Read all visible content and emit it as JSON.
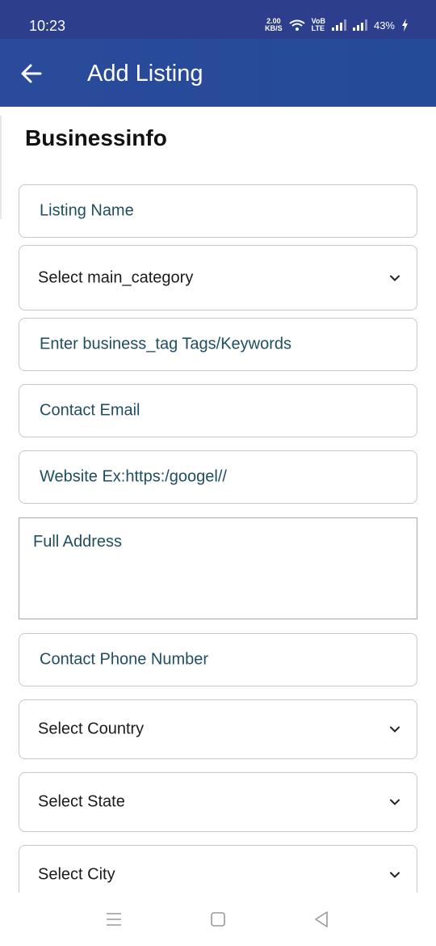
{
  "status_bar": {
    "time": "10:23",
    "net_speed_value": "2.00",
    "net_speed_unit": "KB/S",
    "volte_top": "VoB",
    "volte_bottom": "LTE",
    "battery": "43%"
  },
  "app_bar": {
    "title": "Add Listing",
    "back_icon": "arrow-left-icon"
  },
  "section": {
    "title": "Businessinfo"
  },
  "form": {
    "listing_name_placeholder": "Listing Name",
    "main_category_value": "Select  main_category",
    "tags_placeholder": "Enter business_tag Tags/Keywords",
    "email_placeholder": "Contact Email",
    "website_placeholder": "Website Ex:https:/googel//",
    "address_placeholder": "Full Address",
    "phone_placeholder": "Contact Phone Number",
    "country_value": "Select Country",
    "state_value": "Select State",
    "city_value": "Select City"
  },
  "nav": {
    "menu_icon": "recent-apps-icon",
    "home_icon": "home-icon",
    "back_icon": "nav-back-icon"
  },
  "colors": {
    "status_bar": "#2d3e8d",
    "app_bar": "#2b4a9b",
    "placeholder_text": "#1f4e5f",
    "field_border": "#c8c8c8"
  }
}
